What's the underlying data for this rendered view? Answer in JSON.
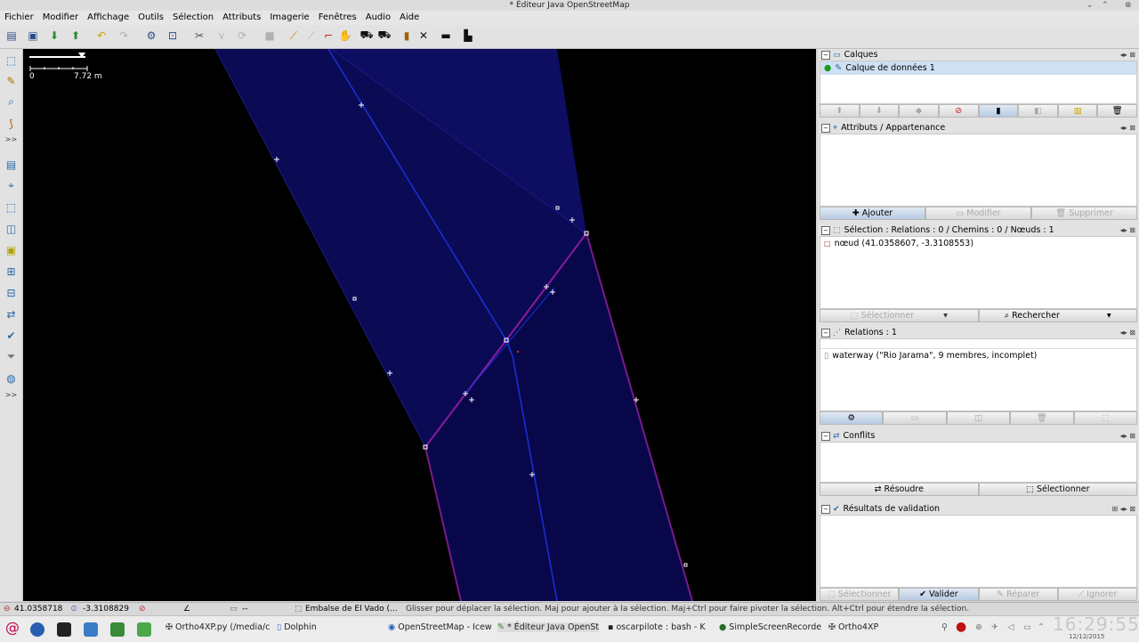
{
  "window": {
    "title": "* Éditeur Java OpenStreetMap"
  },
  "menu": [
    "Fichier",
    "Modifier",
    "Affichage",
    "Outils",
    "Sélection",
    "Attributs",
    "Imagerie",
    "Fenêtres",
    "Audio",
    "Aide"
  ],
  "map": {
    "scale_start": "0",
    "scale_end": "7.72 m"
  },
  "panels": {
    "layers": {
      "title": "Calques",
      "layer_name": "Calque de données 1"
    },
    "attributes": {
      "title": "Attributs / Appartenance",
      "add": "Ajouter",
      "modify": "Modifier",
      "delete": "Supprimer"
    },
    "selection": {
      "title": "Sélection : Relations : 0 / Chemins : 0 / Nœuds : 1",
      "item": "nœud (41.0358607, -3.3108553)",
      "select_btn": "Sélectionner",
      "search_btn": "Rechercher"
    },
    "relations": {
      "title": "Relations : 1",
      "item": "waterway (\"Rio Jarama\", 9 membres, incomplet)"
    },
    "conflicts": {
      "title": "Conflits",
      "resolve": "Résoudre",
      "select": "Sélectionner"
    },
    "validation": {
      "title": "Résultats de validation",
      "select": "Sélectionner",
      "validate": "Valider",
      "fix": "Réparer",
      "ignore": "Ignorer"
    }
  },
  "status": {
    "lat": "41.0358718",
    "lon": "-3.3108829",
    "angle": "--",
    "name": "Embalse de El Vado (...",
    "help": "Glisser pour déplacer la sélection. Maj pour ajouter à la sélection. Maj+Ctrl pour faire pivoter la sélection. Alt+Ctrl pour étendre la sélection."
  },
  "taskbar": {
    "items": [
      "Ortho4XP.py (/media/c",
      "Dolphin",
      "OpenStreetMap - Icew",
      "* Éditeur Java OpenSt",
      "oscarpilote : bash - K",
      "SimpleScreenRecorde",
      "Ortho4XP"
    ],
    "clock": "16:29:55",
    "date": "12/12/2015"
  },
  "colors": {
    "map_bg": "#000000",
    "area_fill": "#0b0b55",
    "way_blue": "#1a2fd6",
    "way_purple": "#7a1a8a"
  }
}
